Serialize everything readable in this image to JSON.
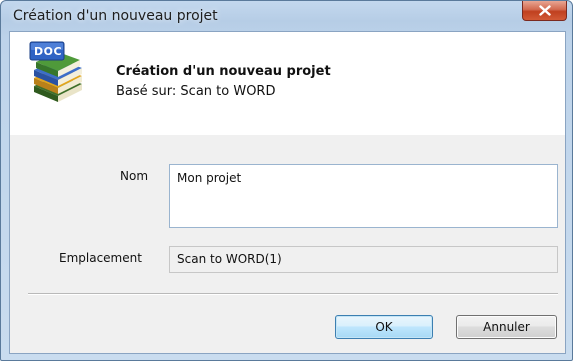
{
  "window": {
    "title": "Création d'un nouveau projet",
    "close_icon": "close-icon"
  },
  "header": {
    "title": "Création d'un nouveau projet",
    "subtitle": "Basé sur: Scan to WORD",
    "icon": "doc-books-icon",
    "icon_badge": "DOC"
  },
  "form": {
    "name_label": "Nom",
    "name_value": "Mon projet",
    "location_label": "Emplacement",
    "location_value": "Scan to WORD(1)"
  },
  "buttons": {
    "ok_label": "OK",
    "cancel_label": "Annuler"
  },
  "colors": {
    "titlebar": "#bdd3ea",
    "close_button": "#c7492a",
    "ok_border": "#3c7fb1"
  }
}
